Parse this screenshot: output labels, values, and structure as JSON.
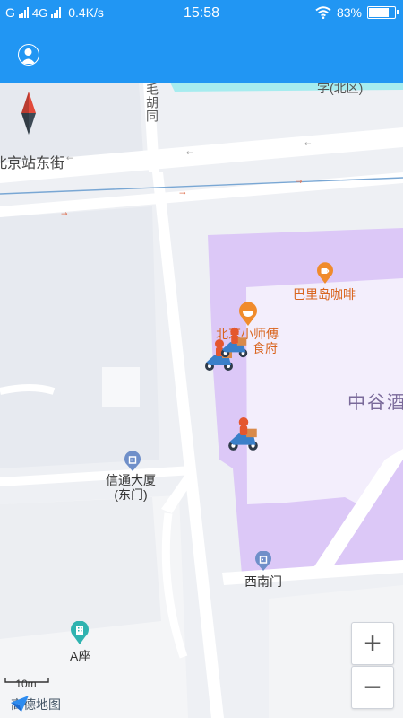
{
  "status_bar": {
    "carrier_left": "G",
    "network": "4G",
    "speed": "0.4K/s",
    "time": "15:58",
    "battery_pct": "83%",
    "battery_level": 0.83
  },
  "map": {
    "streets": {
      "top_street": "学(北区)",
      "hutong": "毛胡同",
      "station_east": "北京站东街"
    },
    "pois": {
      "cafe": "巴里岛咖啡",
      "restaurant_line1": "北京小",
      "restaurant_line1b": "师傅",
      "restaurant_line2": "食府",
      "hotel": "中谷酒",
      "xintong_line1": "信通大厦",
      "xintong_line2": "(东门)",
      "xinanmen": "西南门",
      "a_zuo": "A座"
    },
    "scale_label": "10m",
    "logo_text": "高德地图",
    "zoom_in": "+",
    "zoom_out": "−"
  }
}
